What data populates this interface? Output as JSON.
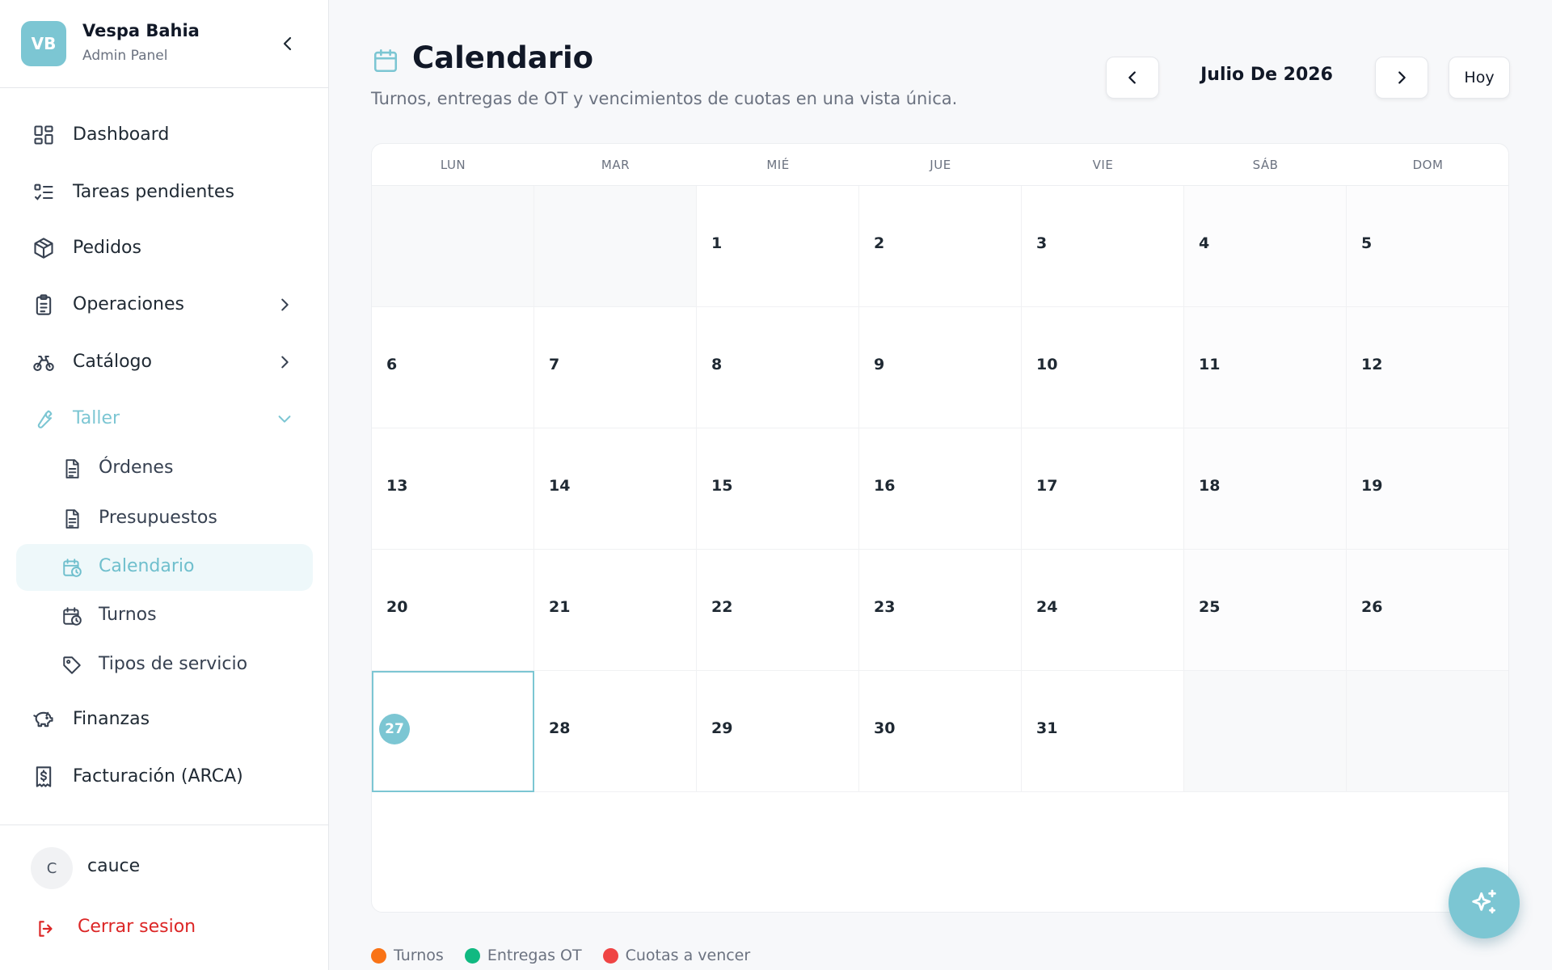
{
  "brand": {
    "initials": "VB",
    "name": "Vespa Bahia",
    "subtitle": "Admin Panel"
  },
  "nav": {
    "dashboard": "Dashboard",
    "tareas": "Tareas pendientes",
    "pedidos": "Pedidos",
    "operaciones": "Operaciones",
    "catalogo": "Catálogo",
    "taller": "Taller",
    "finanzas": "Finanzas",
    "facturacion": "Facturación (ARCA)"
  },
  "taller_sub": {
    "ordenes": "Órdenes",
    "presupuestos": "Presupuestos",
    "calendario": "Calendario",
    "turnos": "Turnos",
    "tipos": "Tipos de servicio"
  },
  "user": {
    "initial": "C",
    "name": "cauce",
    "logout": "Cerrar sesion"
  },
  "page": {
    "title": "Calendario",
    "subtitle": "Turnos, entregas de OT y vencimientos de cuotas en una vista única."
  },
  "calendar": {
    "month_label": "Julio De 2026",
    "today_button": "Hoy",
    "weekdays": [
      "LUN",
      "MAR",
      "MIÉ",
      "JUE",
      "VIE",
      "SÁB",
      "DOM"
    ],
    "today": 27,
    "days": {
      "d1": "1",
      "d2": "2",
      "d3": "3",
      "d4": "4",
      "d5": "5",
      "d6": "6",
      "d7": "7",
      "d8": "8",
      "d9": "9",
      "d10": "10",
      "d11": "11",
      "d12": "12",
      "d13": "13",
      "d14": "14",
      "d15": "15",
      "d16": "16",
      "d17": "17",
      "d18": "18",
      "d19": "19",
      "d20": "20",
      "d21": "21",
      "d22": "22",
      "d23": "23",
      "d24": "24",
      "d25": "25",
      "d26": "26",
      "d27": "27",
      "d28": "28",
      "d29": "29",
      "d30": "30",
      "d31": "31"
    }
  },
  "legend": {
    "turnos": {
      "label": "Turnos",
      "color": "#f97316"
    },
    "entregas": {
      "label": "Entregas OT",
      "color": "#10b981"
    },
    "cuotas": {
      "label": "Cuotas a vencer",
      "color": "#ef4444"
    }
  },
  "colors": {
    "accent": "#7cc6d3",
    "danger": "#dc2626"
  }
}
